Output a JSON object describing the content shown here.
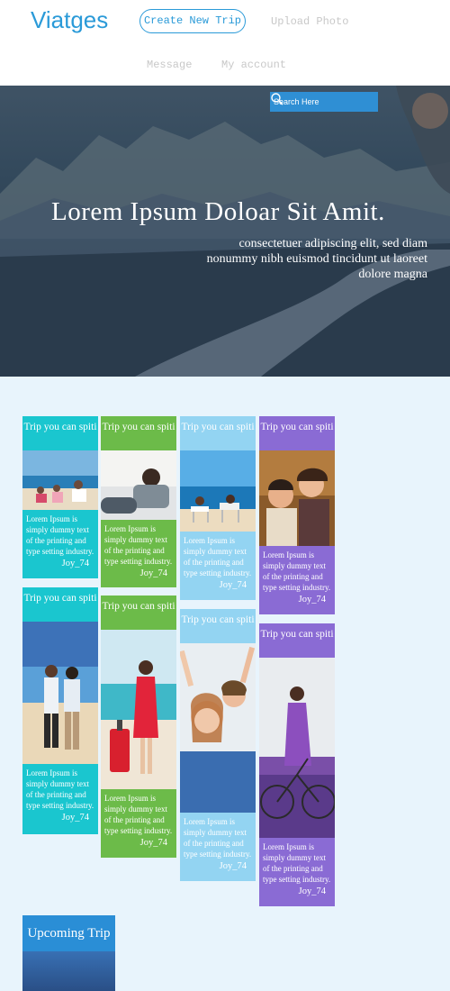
{
  "header": {
    "logo": "Viatges",
    "nav": {
      "create_trip": "Create New Trip",
      "upload_photo": "Upload Photo",
      "message": "Message",
      "my_account": "My account"
    }
  },
  "hero": {
    "search_placeholder": "Search Here",
    "title": "Lorem Ipsum Doloar Sit Amit.",
    "subtitle": "consectetuer adipiscing elit, sed diam nonummy nibh euismod tincidunt ut laoreet dolore magna"
  },
  "cards": [
    {
      "title": "Trip you can spiti",
      "text": "Lorem Ipsum is simply dummy text of the printing and type setting industry.",
      "author": "Joy_74"
    },
    {
      "title": "Trip you can spiti",
      "text": "Lorem Ipsum is simply dummy text of the printing and type setting industry.",
      "author": "Joy_74"
    },
    {
      "title": "Trip you can spiti",
      "text": "Lorem Ipsum is simply dummy text of the printing and type setting industry.",
      "author": "Joy_74"
    },
    {
      "title": "Trip you can spiti",
      "text": "Lorem Ipsum is simply dummy text of the printing and type setting industry.",
      "author": "Joy_74"
    },
    {
      "title": "Trip you can spiti",
      "text": "Lorem Ipsum is simply dummy text of the printing and type setting industry.",
      "author": "Joy_74"
    },
    {
      "title": "Trip you can spiti",
      "text": "Lorem Ipsum is simply dummy text of the printing and type setting industry.",
      "author": "Joy_74"
    },
    {
      "title": "Trip you can spiti",
      "text": "Lorem Ipsum is simply dummy text of the printing and type setting industry.",
      "author": "Joy_74"
    },
    {
      "title": "Trip you can spiti",
      "text": "Lorem Ipsum is simply dummy text of the printing and type setting industry.",
      "author": "Joy_74"
    }
  ],
  "upcoming": {
    "title": "Upcoming Trip"
  },
  "colors": {
    "accent": "#2a9ad8",
    "teal": "#1ac6cf",
    "green": "#6cbb49",
    "light_blue": "#93d4f2",
    "purple": "#8a6bd4",
    "page_bg": "#e8f4fc"
  },
  "icons": {
    "search": "search-icon"
  }
}
